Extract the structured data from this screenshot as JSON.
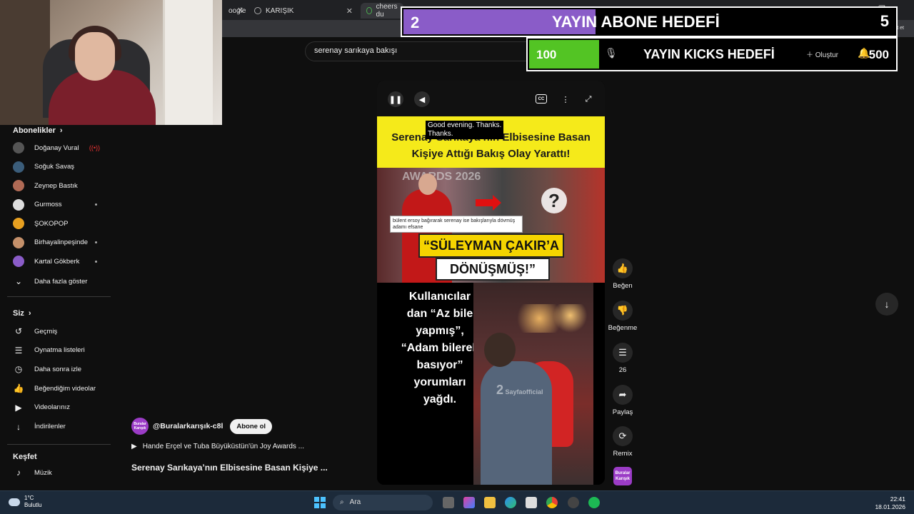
{
  "browser": {
    "tabs": [
      {
        "label": "oogle",
        "active": false
      },
      {
        "label": "KARIŞIK",
        "active": false
      },
      {
        "label": "cheers du",
        "active": true
      }
    ]
  },
  "search": {
    "value": "serenay sarıkaya bakışı"
  },
  "overlays": {
    "goal1": {
      "current": "2",
      "title": "YAYIN ABONE HEDEFİ",
      "target": "5",
      "progress": 0.4,
      "color": "#8a5cc8"
    },
    "goal2": {
      "current": "100",
      "title": "YAYIN KICKS HEDEFİ",
      "target": "500",
      "progress": 0.2,
      "color": "#53c424"
    },
    "create_label": "Oluştur",
    "chat_label": "Sohbet et"
  },
  "sidebar": {
    "subscriptions_title": "Abonelikler",
    "subscriptions": [
      {
        "name": "Doğanay Vural",
        "indicator": "live",
        "color": "#555555"
      },
      {
        "name": "Soğuk Savaş",
        "indicator": "",
        "color": "#3b5d7a"
      },
      {
        "name": "Zeynep Bastık",
        "indicator": "",
        "color": "#b06a55"
      },
      {
        "name": "Gurmoss",
        "indicator": "dot",
        "color": "#dddddd"
      },
      {
        "name": "ŞOKOPOP",
        "indicator": "",
        "color": "#e8a020"
      },
      {
        "name": "Birhayalinpeşinde",
        "indicator": "dot",
        "color": "#c4906a"
      },
      {
        "name": "Kartal Gökberk",
        "indicator": "dot",
        "color": "#8a5cc8"
      }
    ],
    "show_more": "Daha fazla göster",
    "you_title": "Siz",
    "you_items": [
      {
        "label": "Geçmiş",
        "icon": "history-icon"
      },
      {
        "label": "Oynatma listeleri",
        "icon": "playlist-icon"
      },
      {
        "label": "Daha sonra izle",
        "icon": "clock-icon"
      },
      {
        "label": "Beğendiğim videolar",
        "icon": "like-icon"
      },
      {
        "label": "Videolarınız",
        "icon": "video-icon"
      },
      {
        "label": "İndirilenler",
        "icon": "download-icon"
      }
    ],
    "explore_title": "Keşfet",
    "explore_items": [
      {
        "label": "Müzik",
        "icon": "music-icon"
      }
    ]
  },
  "video": {
    "caption_line1": "Good evening.  Thanks.",
    "caption_line2": "Thanks.",
    "headline": "Serenay Sarıkaya’nın Elbisesine Basan Kişiye Attığı Bakış Olay Yarattı!",
    "awards_text": "AWARDS 2026",
    "comment": "bülent ersoy bağırarak serenay ise bakışlarıyla dövmüş adamı efsane",
    "banner1": "“SÜLEYMAN ÇAKIR’A",
    "banner2": "DÖNÜŞMÜŞ!”",
    "quote": "Kullanıcılar dan “Az bile yapmış”, “Adam bilerek basıyor” yorumları yağdı.",
    "watermark_num": "2",
    "watermark_text": "Sayfaofficial",
    "qmark": "?"
  },
  "actions": {
    "like": "Beğen",
    "dislike": "Beğenme",
    "comments": "26",
    "share": "Paylaş",
    "remix": "Remix"
  },
  "channel": {
    "handle": "@Buralarkarışık-c8l",
    "logo_text": "Buralar Karışık",
    "subscribe": "Abone ol",
    "playlist_link": "Hande Erçel ve Tuba Büyüküstün'ün Joy Awards ...",
    "title": "Serenay Sarıkaya’nın Elbisesine Basan Kişiye ..."
  },
  "taskbar": {
    "temp": "1°C",
    "weather": "Bulutlu",
    "search_placeholder": "Ara",
    "time": "22:41",
    "date": "18.01.2026"
  }
}
